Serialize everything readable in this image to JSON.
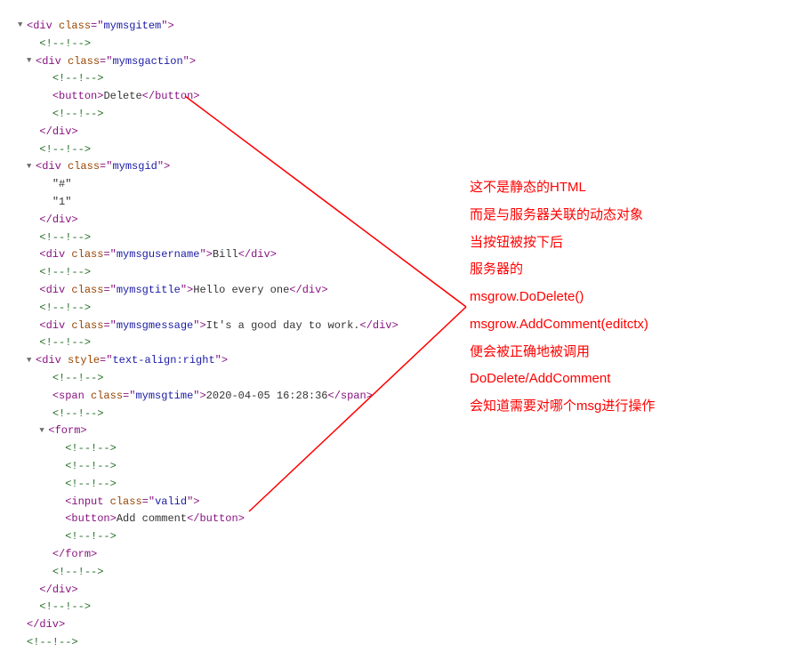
{
  "dom": {
    "l1_open": "<div class=\"mymsgitem\">",
    "l2_cmt": "<!--!-->",
    "l3_open": "<div class=\"mymsgaction\">",
    "l4_cmt": "<!--!-->",
    "l5_btn": "<button>Delete</button>",
    "l6_cmt": "<!--!-->",
    "l7_close": "</div>",
    "l8_cmt": "<!--!-->",
    "l9_open": "<div class=\"mymsgid\">",
    "l10_txt": "\"#\"",
    "l11_txt": "\"1\"",
    "l12_close": "</div>",
    "l13_cmt": "<!--!-->",
    "l14_user": "<div class=\"mymsgusername\">Bill</div>",
    "l15_cmt": "<!--!-->",
    "l16_title": "<div class=\"mymsgtitle\">Hello every one</div>",
    "l17_cmt": "<!--!-->",
    "l18_msg": "<div class=\"mymsgmessage\">It's a good day to work.</div>",
    "l19_cmt": "<!--!-->",
    "l20_open": "<div style=\"text-align:right\">",
    "l21_cmt": "<!--!-->",
    "l22_time": "<span class=\"mymsgtime\">2020-04-05 16:28:36</span>",
    "l23_cmt": "<!--!-->",
    "l24_open": "<form>",
    "l25_cmt": "<!--!-->",
    "l26_cmt": "<!--!-->",
    "l27_cmt": "<!--!-->",
    "l28_input": "<input class=\"valid\">",
    "l29_btn": "<button>Add comment</button>",
    "l30_cmt": "<!--!-->",
    "l31_close": "</form>",
    "l32_cmt": "<!--!-->",
    "l33_close": "</div>",
    "l34_cmt": "<!--!-->",
    "l35_close": "</div>",
    "l36_cmt": "<!--!-->"
  },
  "tags": {
    "div": "div",
    "button": "button",
    "span": "span",
    "form": "form",
    "input": "input"
  },
  "attrs": {
    "class": "class",
    "style": "style",
    "mymsgitem": "mymsgitem",
    "mymsgaction": "mymsgaction",
    "mymsgid": "mymsgid",
    "mymsgusername": "mymsgusername",
    "mymsgtitle": "mymsgtitle",
    "mymsgmessage": "mymsgmessage",
    "mymsgtime": "mymsgtime",
    "text_align_right": "text-align:right",
    "valid": "valid"
  },
  "content": {
    "delete": "Delete",
    "hash": "\"#\"",
    "one": "\"1\"",
    "bill": "Bill",
    "hello": "Hello every one",
    "goodday": "It's a good day to work.",
    "timestamp": "2020-04-05 16:28:36",
    "addcomment": "Add comment"
  },
  "comment": "<!--!-->",
  "annotations": {
    "a1": "这不是静态的HTML",
    "a2": "而是与服务器关联的动态对象",
    "a3": "当按钮被按下后",
    "a4": "服务器的",
    "a5": "msgrow.DoDelete()",
    "a6": "msgrow.AddComment(editctx)",
    "a7": "便会被正确地被调用",
    "a8": "DoDelete/AddComment",
    "a9": "会知道需要对哪个msg进行操作"
  },
  "arrow_color": "#ff0000"
}
